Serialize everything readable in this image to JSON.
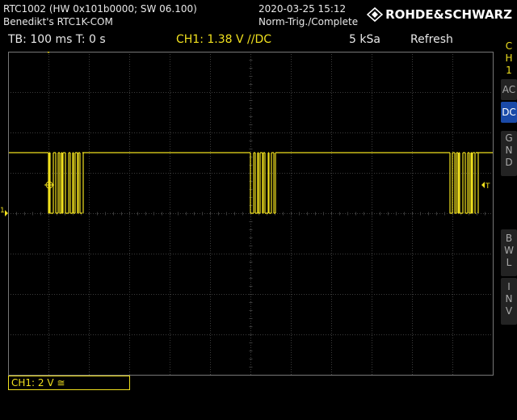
{
  "header": {
    "device_title": "RTC1002 (HW 0x101b0000; SW 06.100)",
    "device_owner": "Benedikt's RTC1K-COM",
    "date": "2020-03-25 15:12",
    "trigger_status": "Norm-Trig./Complete",
    "brand": "ROHDE&SCHWARZ"
  },
  "statusbar": {
    "timebase": "TB: 100 ms  T: 0 s",
    "ch1": "CH1: 1.38 V ∕/DC",
    "samplerate": "5 kSa",
    "mode": "Refresh"
  },
  "side_menu": {
    "channel": [
      "C",
      "H",
      "1"
    ],
    "coupling_ac": "AC",
    "coupling_dc": "DC",
    "gnd": [
      "G",
      "N",
      "D"
    ],
    "bwl": [
      "B",
      "W",
      "L"
    ],
    "inv": [
      "I",
      "N",
      "V"
    ]
  },
  "markers": {
    "ch1_ground": "1",
    "trigger_level": "T"
  },
  "scale_box": "CH1: 2 V ≅",
  "colors": {
    "trace": "#f0e01e",
    "grid": "#3c3c3c",
    "background": "#000000",
    "selected": "#1a4aa8"
  }
}
